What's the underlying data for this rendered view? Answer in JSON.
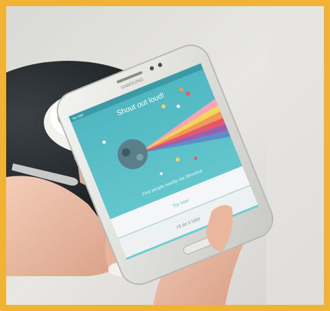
{
  "image": {
    "frame_color": "#f2b233",
    "scene": "hands-holding-phone-cafe",
    "phone": {
      "brand": "SAMSUNG",
      "status_carrier": "No SIM",
      "app": {
        "title": "Shout out loud!",
        "tagline": "Find people nearby via Shoutout",
        "primary_button": "Try now",
        "secondary_button": "I'll do it later",
        "accent_color": "#5cc2c8"
      }
    }
  }
}
